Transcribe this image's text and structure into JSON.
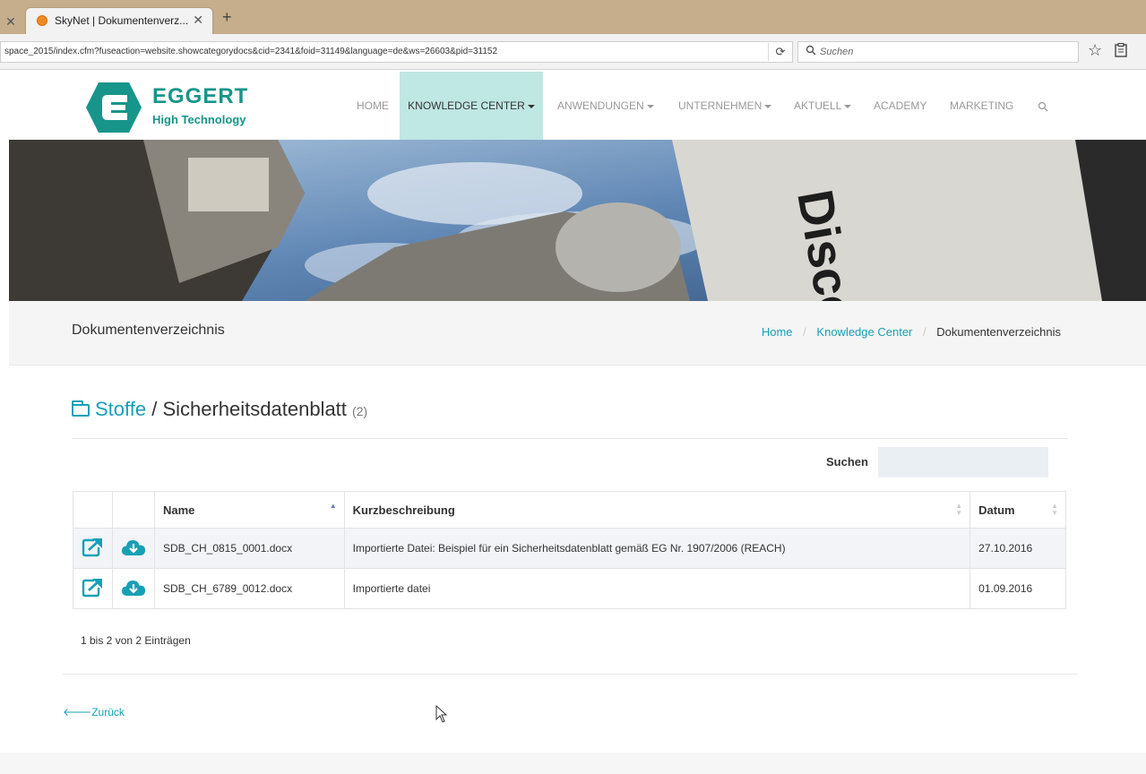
{
  "browser": {
    "tab_title": "SkyNet | Dokumentenverz...",
    "url": "space_2015/index.cfm?fuseaction=website.showcategorydocs&cid=2341&foid=31149&language=de&ws=26603&pid=31152",
    "search_placeholder": "Suchen"
  },
  "site": {
    "logo_name": "EGGERT",
    "logo_sub": "High Technology",
    "brand_color": "#17958a",
    "menu": [
      {
        "label": "HOME",
        "dropdown": false
      },
      {
        "label": "KNOWLEDGE CENTER",
        "dropdown": true,
        "active": true
      },
      {
        "label": "ANWENDUNGEN",
        "dropdown": true
      },
      {
        "label": "UNTERNEHMEN",
        "dropdown": true
      },
      {
        "label": "AKTUELL",
        "dropdown": true
      },
      {
        "label": "ACADEMY",
        "dropdown": false
      },
      {
        "label": "MARKETING",
        "dropdown": false
      }
    ]
  },
  "page": {
    "title": "Dokumentenverzeichnis",
    "breadcrumb": [
      "Home",
      "Knowledge Center",
      "Dokumentenverzeichnis"
    ],
    "heading_folder": "Stoffe",
    "heading_sep": " / ",
    "heading_title": "Sicherheitsdatenblatt",
    "heading_count": "(2)",
    "search_label": "Suchen",
    "table": {
      "columns": [
        "",
        "",
        "Name",
        "Kurzbeschreibung",
        "Datum"
      ],
      "rows": [
        {
          "name": "SDB_CH_0815_0001.docx",
          "description": "Importierte Datei: Beispiel für ein Sicherheitsdatenblatt gemäß EG Nr. 1907/2006 (REACH)",
          "date": "27.10.2016"
        },
        {
          "name": "SDB_CH_6789_0012.docx",
          "description": "Importierte datei",
          "date": "01.09.2016"
        }
      ]
    },
    "info": "1 bis 2 von 2 Einträgen",
    "back_label": "Zurück",
    "accent_color": "#17a0b5"
  }
}
